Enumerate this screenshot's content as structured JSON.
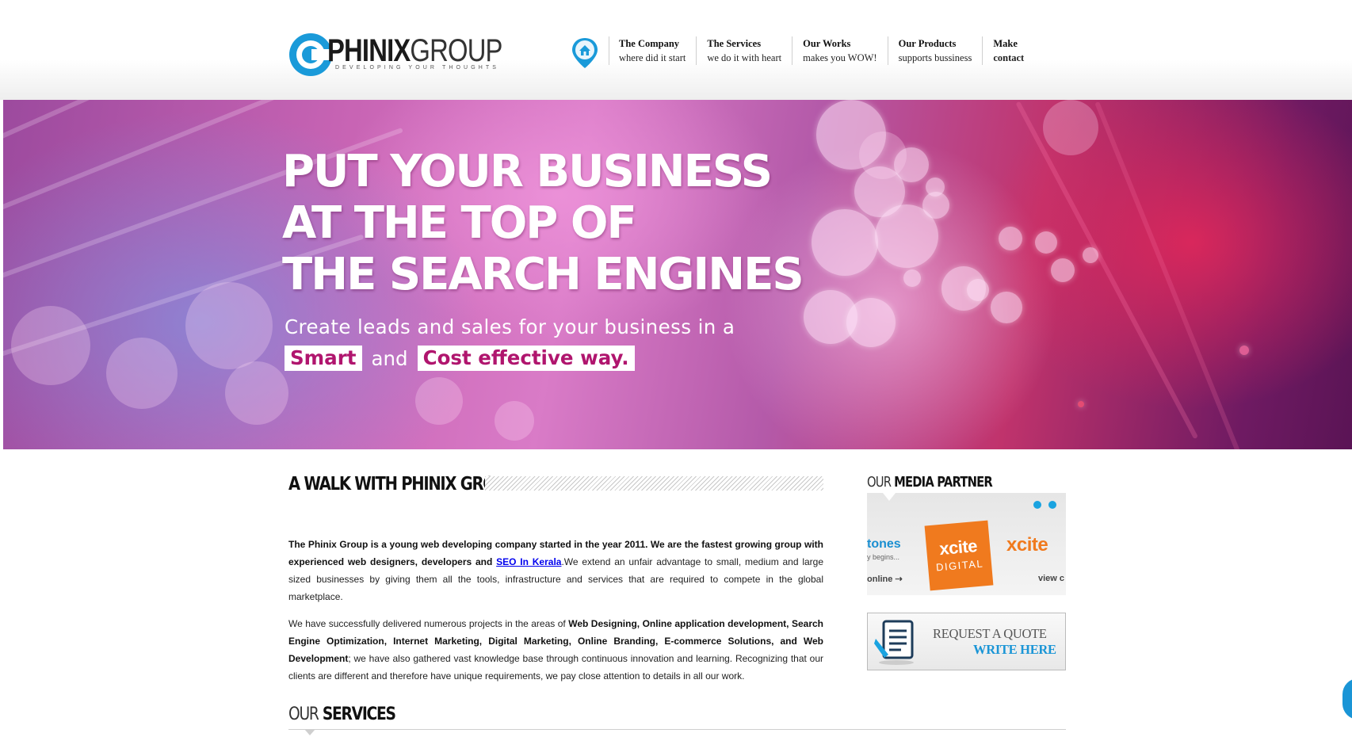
{
  "header": {
    "logo": {
      "name": "PHINIX",
      "name2": "GROUP",
      "tagline": "DEVELOPING YOUR THOUGHTS"
    },
    "nav": [
      {
        "title": "The Company",
        "subtitle": "where did it start"
      },
      {
        "title": "The Services",
        "subtitle": "we do it with heart"
      },
      {
        "title": "Our Works",
        "subtitle": "makes you WOW!"
      },
      {
        "title": "Our Products",
        "subtitle": "supports bussiness"
      },
      {
        "title": "Make",
        "subtitle": "contact"
      }
    ]
  },
  "banner": {
    "headline": [
      "PUT YOUR BUSINESS",
      "AT THE TOP OF",
      "THE SEARCH ENGINES"
    ],
    "subline": "Create leads and sales for your business in a",
    "highlight1": "Smart",
    "connector": "and",
    "highlight2": "Cost effective way."
  },
  "main": {
    "title": "A WALK WITH PHINIX GROUP",
    "p1_bold": "The Phinix Group is a young web developing company started in the year 2011. We are the fastest growing group with experienced web designers, developers and ",
    "p1_link": "SEO In Kerala",
    "p1_rest": ".We extend an unfair advantage to small, medium and large sized businesses by giving them all the tools, infrastructure and services that are required to compete in the global marketplace.",
    "p2_start": "We have successfully delivered numerous projects in the areas of ",
    "p2_bold": "Web Designing, Online application development, Search Engine Optimization, Internet Marketing, Digital Marketing, Online Branding, E-commerce Solutions, and Web Development",
    "p2_rest": "; we have also gathered vast knowledge base through continuous innovation and learning. Recognizing that our clients are different and therefore have unique requirements, we pay close attention to details in all our work.",
    "services_title_a": "OUR",
    "services_title_b": "SERVICES"
  },
  "sidebar": {
    "media_title_a": "OUR",
    "media_title_b": "MEDIA PARTNER",
    "slides": {
      "tones": "tones",
      "tones_sub": "y begins...",
      "online": "online",
      "xcite_tile_a": "xcite",
      "xcite_tile_b": "DIGITAL",
      "xcite_word": "xcite",
      "view": "view c"
    },
    "quote_line1": "REQUEST A QUOTE",
    "quote_line2": "WRITE HERE"
  },
  "colors": {
    "accent": "#1a95d6",
    "brand_pink": "#b0156e",
    "orange": "#f07a1e"
  }
}
